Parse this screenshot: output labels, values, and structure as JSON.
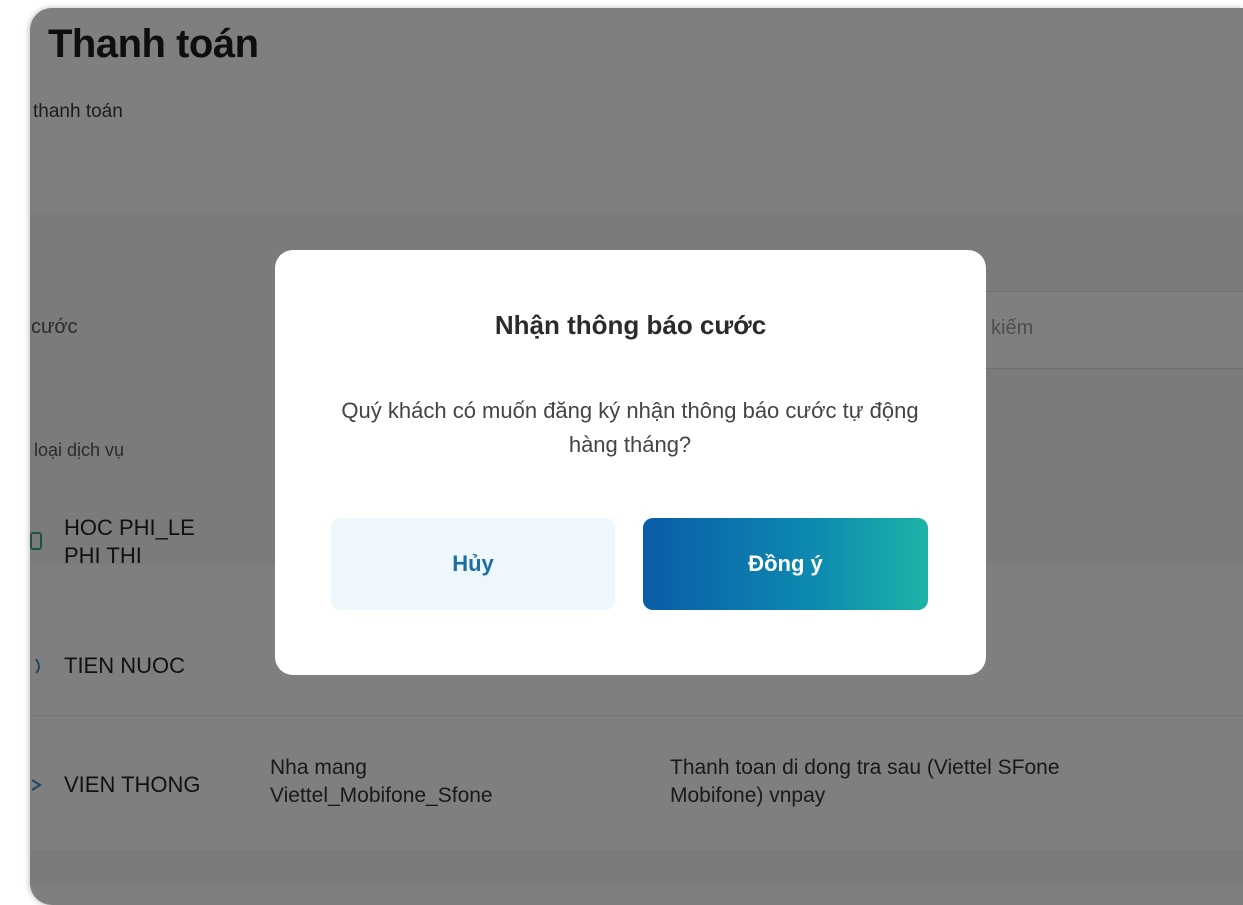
{
  "page": {
    "title": "Thanh toán",
    "subtitle": "thanh toán"
  },
  "filters": {
    "label": "cước",
    "search_placeholder": "kiếm"
  },
  "list": {
    "header": "loại dịch vụ",
    "rows": [
      {
        "name_line1": "HOC PHI_LE",
        "name_line2": "PHI THI",
        "col2_line1": "",
        "col2_line2": "",
        "col3_line1": "",
        "col3_line2": ""
      },
      {
        "name_line1": "TIEN NUOC",
        "name_line2": "",
        "col2_line1": "",
        "col2_line2": "",
        "col3_line1": "",
        "col3_line2": ""
      },
      {
        "name_line1": "VIEN THONG",
        "name_line2": "",
        "col2_line1": "Nha mang",
        "col2_line2": "Viettel_Mobifone_Sfone",
        "col3_line1": "Thanh toan di dong tra sau (Viettel SFone",
        "col3_line2": "Mobifone) vnpay"
      }
    ]
  },
  "modal": {
    "title": "Nhận thông báo cước",
    "message": "Quý khách có muốn đăng ký nhận thông báo cước tự động hàng tháng?",
    "cancel_label": "Hủy",
    "confirm_label": "Đồng ý"
  },
  "colors": {
    "accent_blue": "#0a5ca8",
    "accent_teal": "#1bb3a6",
    "cancel_bg": "#eef7fc",
    "overlay": "rgba(0,0,0,0.5)"
  }
}
